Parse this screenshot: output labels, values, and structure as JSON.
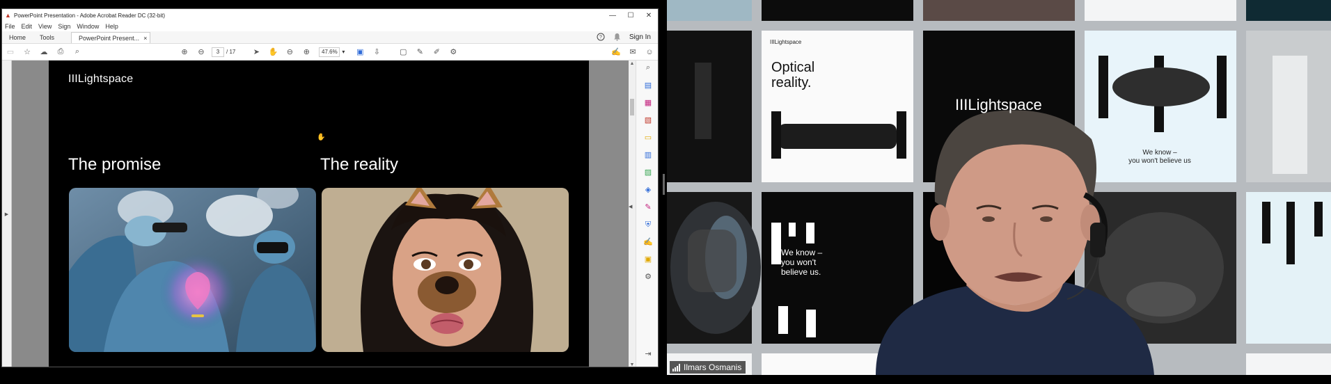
{
  "window": {
    "title": "PowerPoint Presentation - Adobe Acrobat Reader DC (32-bit)",
    "minimize": "—",
    "maximize": "☐",
    "close": "✕"
  },
  "menu": [
    "File",
    "Edit",
    "View",
    "Sign",
    "Window",
    "Help"
  ],
  "tabs": {
    "home": "Home",
    "tools": "Tools",
    "document": "PowerPoint Present...",
    "close": "×",
    "sign_in": "Sign In"
  },
  "toolbar": {
    "page_current": "3",
    "page_total": "/ 17",
    "zoom": "47.6%"
  },
  "slide": {
    "logo": "IIILightspace",
    "promise_heading": "The promise",
    "reality_heading": "The reality"
  },
  "video": {
    "participant_name": "Ilmars Osmanis",
    "tile_optical_line1": "Optical",
    "tile_optical_line2": "reality.",
    "tile_logo_small": "IIILightspace",
    "tile_logo_large": "IIILightspace",
    "tile_weknow_small_line1": "We know –",
    "tile_weknow_small_line2": "you won't believe us",
    "tile_weknow_line1": "We know –",
    "tile_weknow_line2": "you won't",
    "tile_weknow_line3": "believe us."
  },
  "colors": {
    "acrobat_accent": "#c0392b",
    "tool_magenta": "#c21e7b",
    "tool_blue": "#2f6bd8",
    "tool_green": "#3aa655",
    "tool_yellow": "#e0a800"
  }
}
